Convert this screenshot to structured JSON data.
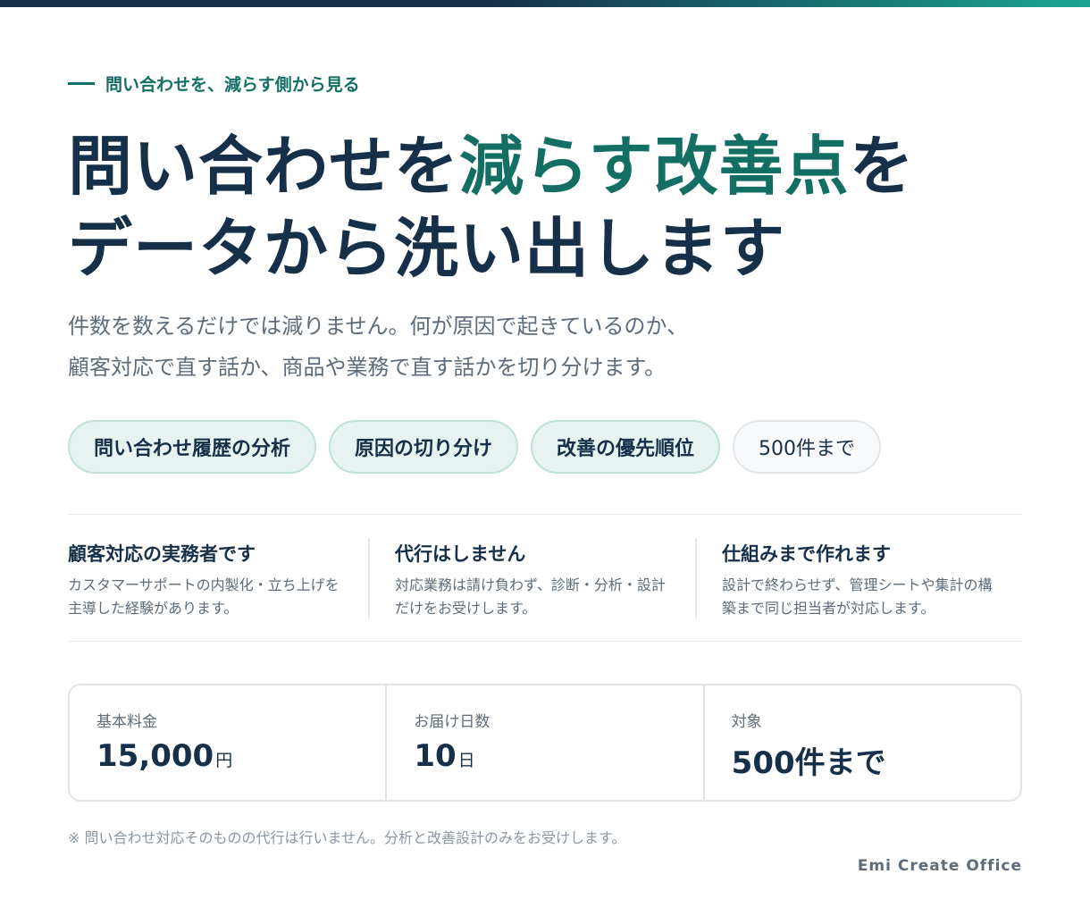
{
  "eyebrow": "問い合わせを、減らす側から見る",
  "headline": {
    "line1_a": "問い合わせを",
    "line1_accent": "減らす改善点",
    "line1_b": "を",
    "line2": "データから洗い出します"
  },
  "lead": {
    "line1": "件数を数えるだけでは減りません。何が原因で起きているのか、",
    "line2": "顧客対応で直す話か、商品や業務で直す話かを切り分けます。"
  },
  "tags": [
    "問い合わせ履歴の分析",
    "原因の切り分け",
    "改善の優先順位",
    "500件まで"
  ],
  "features": [
    {
      "title": "顧客対応の実務者です",
      "line1": "カスタマーサポートの内製化・立ち上げを",
      "line2": "主導した経験があります。"
    },
    {
      "title": "代行はしません",
      "line1": "対応業務は請け負わず、診断・分析・設計",
      "line2": "だけをお受けします。"
    },
    {
      "title": "仕組みまで作れます",
      "line1": "設計で終わらせず、管理シートや集計の構",
      "line2": "築まで同じ担当者が対応します。"
    }
  ],
  "pricing": [
    {
      "label": "基本料金",
      "value": "15,000",
      "unit": "円"
    },
    {
      "label": "お届け日数",
      "value": "10",
      "unit": "日"
    },
    {
      "label": "対象",
      "value": "500件まで",
      "unit": ""
    }
  ],
  "note": "※ 問い合わせ対応そのものの代行は行いません。分析と改善設計のみをお受けします。",
  "brand": "Emi Create Office",
  "colors": {
    "navy": "#17304a",
    "accent": "#136e64",
    "muted": "#5d6b7a",
    "tag_bg": "#e6f3f0"
  }
}
